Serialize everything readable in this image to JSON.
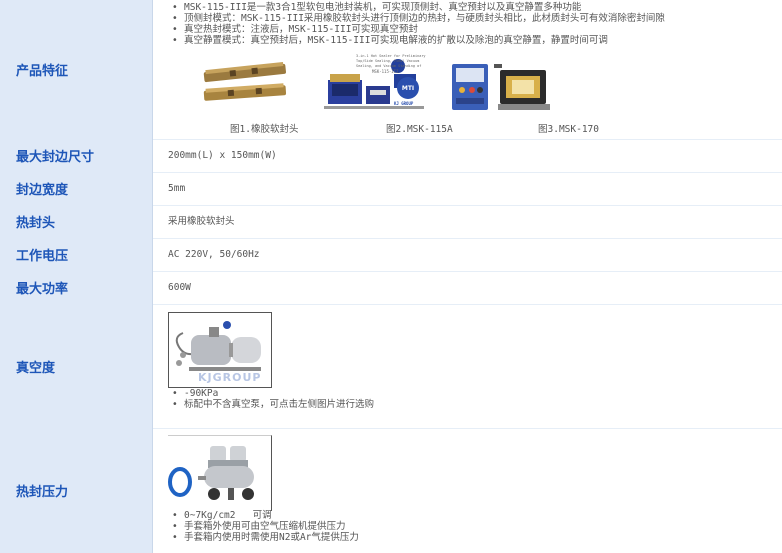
{
  "features": {
    "label": "产品特征",
    "bullets": [
      "MSK-115-III是一款3合1型软包电池封装机，可实现顶侧封、真空预封以及真空静置多种功能",
      "顶侧封模式：MSK-115-III采用橡胶软封头进行顶侧边的热封，与硬质封头相比，此材质封头可有效消除密封间隙",
      "真空热封模式：注液后，MSK-115-III可实现真空预封",
      "真空静置模式：真空预封后，MSK-115-III可实现电解液的扩散以及除泡的真空静置，静置时间可调"
    ],
    "captions": [
      "图1.橡胶软封头",
      "图2.MSK-115A",
      "图3.MSK-170"
    ],
    "fig2_text": "3-in-1 Hot Sealer for Preliminary Top/Side Sealing, Final Vacuum Sealing, and Vacuum Standing of Pouch Cell",
    "fig2_model": "MSK-115-III",
    "logo": "MTI",
    "logo_sub": "KJ GROUP"
  },
  "rows": [
    {
      "label": "最大封边尺寸",
      "value": "200mm(L) x 150mm(W)"
    },
    {
      "label": "封边宽度",
      "value": "5mm"
    },
    {
      "label": "热封头",
      "value": "采用橡胶软封头"
    },
    {
      "label": "工作电压",
      "value": "AC 220V, 50/60Hz"
    },
    {
      "label": "最大功率",
      "value": "600W"
    }
  ],
  "vacuum": {
    "label": "真空度",
    "bullets": [
      "-90KPa",
      "标配中不含真空泵，可点击左侧图片进行选购"
    ],
    "watermark": "KJGROUP"
  },
  "pressure": {
    "label": "热封压力",
    "bullets": [
      "0~7Kg/cm2   可调",
      "手套箱外使用可由空气压缩机提供压力",
      "手套箱内使用时需使用N2或Ar气提供压力"
    ]
  }
}
